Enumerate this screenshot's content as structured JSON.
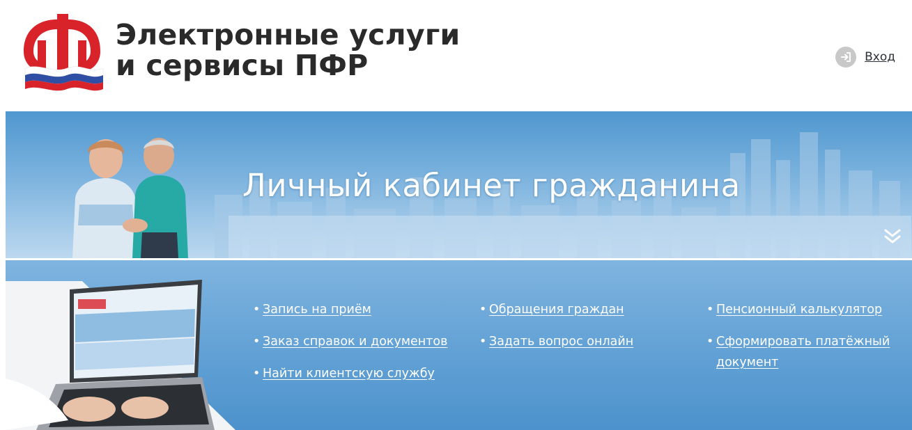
{
  "header": {
    "title_line1": "Электронные услуги",
    "title_line2": "и сервисы ПФР",
    "login_label": "Вход",
    "logo_icon": "pfr-logo-icon",
    "login_icon": "login-arrow-icon"
  },
  "banner": {
    "title": "Личный кабинет гражданина",
    "expand_icon": "double-chevron-down-icon"
  },
  "services": {
    "column1": [
      {
        "label": "Запись на приём"
      },
      {
        "label": "Заказ справок и документов"
      },
      {
        "label": "Найти клиентскую службу"
      }
    ],
    "column2": [
      {
        "label": "Обращения граждан"
      },
      {
        "label": "Задать вопрос онлайн"
      }
    ],
    "column3": [
      {
        "label": "Пенсионный калькулятор"
      },
      {
        "label": "Сформировать платёжный документ"
      }
    ]
  },
  "colors": {
    "logo_red": "#d8232a",
    "banner_blue": "#5a9fd6",
    "title_text": "#2a2a2a",
    "link_white": "#ffffff"
  }
}
